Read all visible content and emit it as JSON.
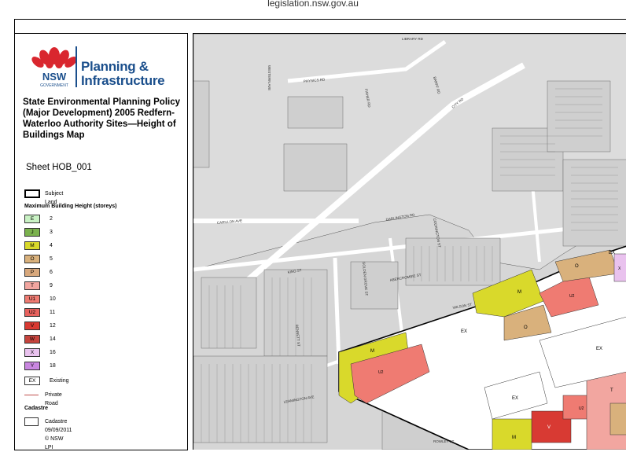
{
  "header": {
    "site": "legislation.nsw.gov.au"
  },
  "logo": {
    "gov_top": "NSW",
    "gov_bottom": "GOVERNMENT",
    "brand_line1": "Planning &",
    "brand_line2": "Infrastructure"
  },
  "legend": {
    "title": "State Environmental Planning Policy (Major Development) 2005 Redfern-Waterloo Authority Sites—Height of Buildings Map",
    "sheet": "Sheet HOB_001",
    "subject_land": "Subject Land",
    "height_heading": "Maximum Building Height (storeys)",
    "height_items": [
      {
        "code": "E",
        "value": "2",
        "color": "#c9f2c4"
      },
      {
        "code": "J",
        "value": "3",
        "color": "#7bb24e"
      },
      {
        "code": "M",
        "value": "4",
        "color": "#d9d92b"
      },
      {
        "code": "O",
        "value": "5",
        "color": "#d9b17c"
      },
      {
        "code": "P",
        "value": "6",
        "color": "#d8a87c"
      },
      {
        "code": "T",
        "value": "9",
        "color": "#f2a6a0"
      },
      {
        "code": "U1",
        "value": "10",
        "color": "#ef7b72"
      },
      {
        "code": "U2",
        "value": "11",
        "color": "#e8625e"
      },
      {
        "code": "V",
        "value": "12",
        "color": "#d83a33"
      },
      {
        "code": "W",
        "value": "14",
        "color": "#c6443d"
      },
      {
        "code": "X",
        "value": "16",
        "color": "#e9c2ee"
      },
      {
        "code": "Y",
        "value": "18",
        "color": "#c987e0"
      }
    ],
    "existing_code": "EX",
    "existing_label": "Existing",
    "private_road": "Private Road",
    "cadastre_heading": "Cadastre",
    "cadastre_label": "Cadastre 09/09/2011 © NSW LPI"
  },
  "map": {
    "streets": [
      "LIBRARY RD",
      "WESTERN AVE",
      "PHYSICS RD",
      "FISHER RD",
      "BARFF RD",
      "CITY RD",
      "CARILLON AVE",
      "DARLINGTON RD",
      "CODRINGTON ST",
      "KING ST",
      "GOLDEN GROVE ST",
      "ABERCROMBIE ST",
      "WILSON ST",
      "BENNETT ST",
      "LEAMINGTON AVE",
      "ROWLEY ST"
    ],
    "zones": {
      "ex": "EX",
      "m": "M",
      "o": "O",
      "u2": "U2",
      "v": "V",
      "x": "X",
      "t": "T"
    }
  }
}
